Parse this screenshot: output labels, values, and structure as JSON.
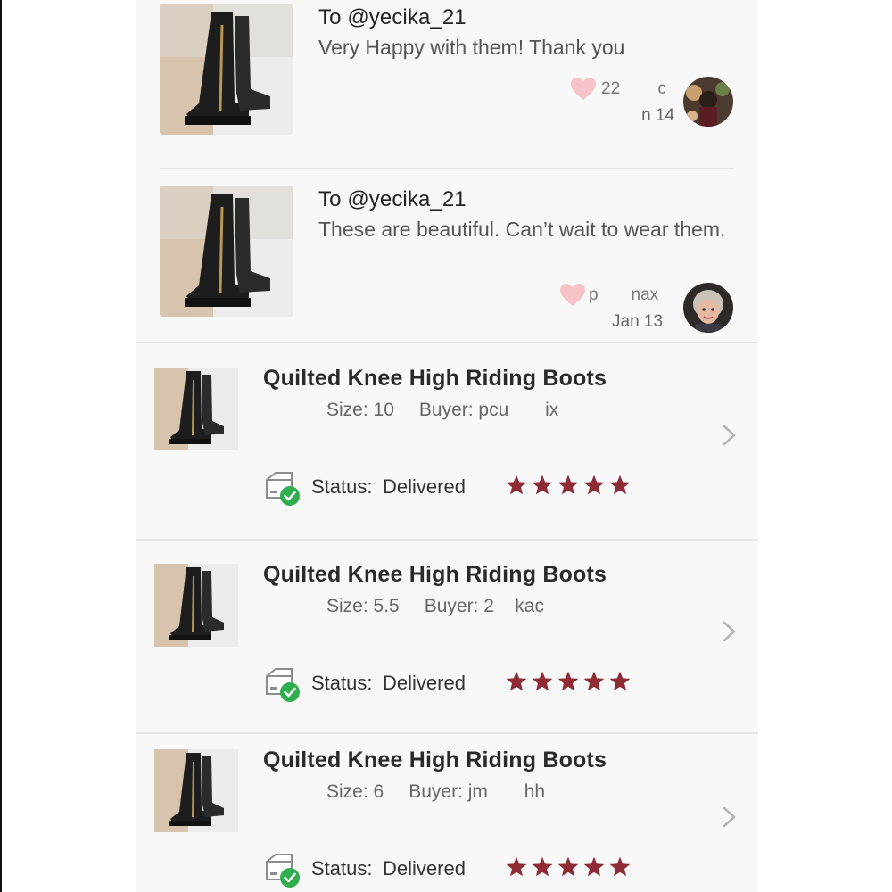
{
  "comments": [
    {
      "to": "To @yecika_21",
      "text": "Very Happy with them! Thank you",
      "user": "22        c",
      "date": "    n 14"
    },
    {
      "to": "To @yecika_21",
      "text": "These are beautiful. Can’t wait to wear them.",
      "user": "p       nax",
      "date": "Jan 13"
    }
  ],
  "orders": [
    {
      "title": "Quilted Knee High Riding Boots",
      "size": "Size: 10",
      "buyer": "Buyer: pcu       ix",
      "status_label": "Status:",
      "status_value": "Delivered",
      "rating": 5
    },
    {
      "title": "Quilted Knee High Riding Boots",
      "size": "Size: 5.5",
      "buyer": "Buyer: 2    kac",
      "status_label": "Status:",
      "status_value": "Delivered",
      "rating": 5
    },
    {
      "title": "Quilted Knee High Riding Boots",
      "size": "Size: 6",
      "buyer": "Buyer: jm       hh",
      "status_label": "Status:",
      "status_value": "Delivered",
      "rating": 5
    }
  ],
  "icons": {
    "heart": "heart-icon",
    "chevron": "chevron-right-icon",
    "status": "delivered-box-icon",
    "star": "star-icon"
  },
  "colors": {
    "heart": "#f6c4c8",
    "star": "#8e2b34",
    "check": "#2fae4e",
    "chevron": "#b5b5b8"
  }
}
